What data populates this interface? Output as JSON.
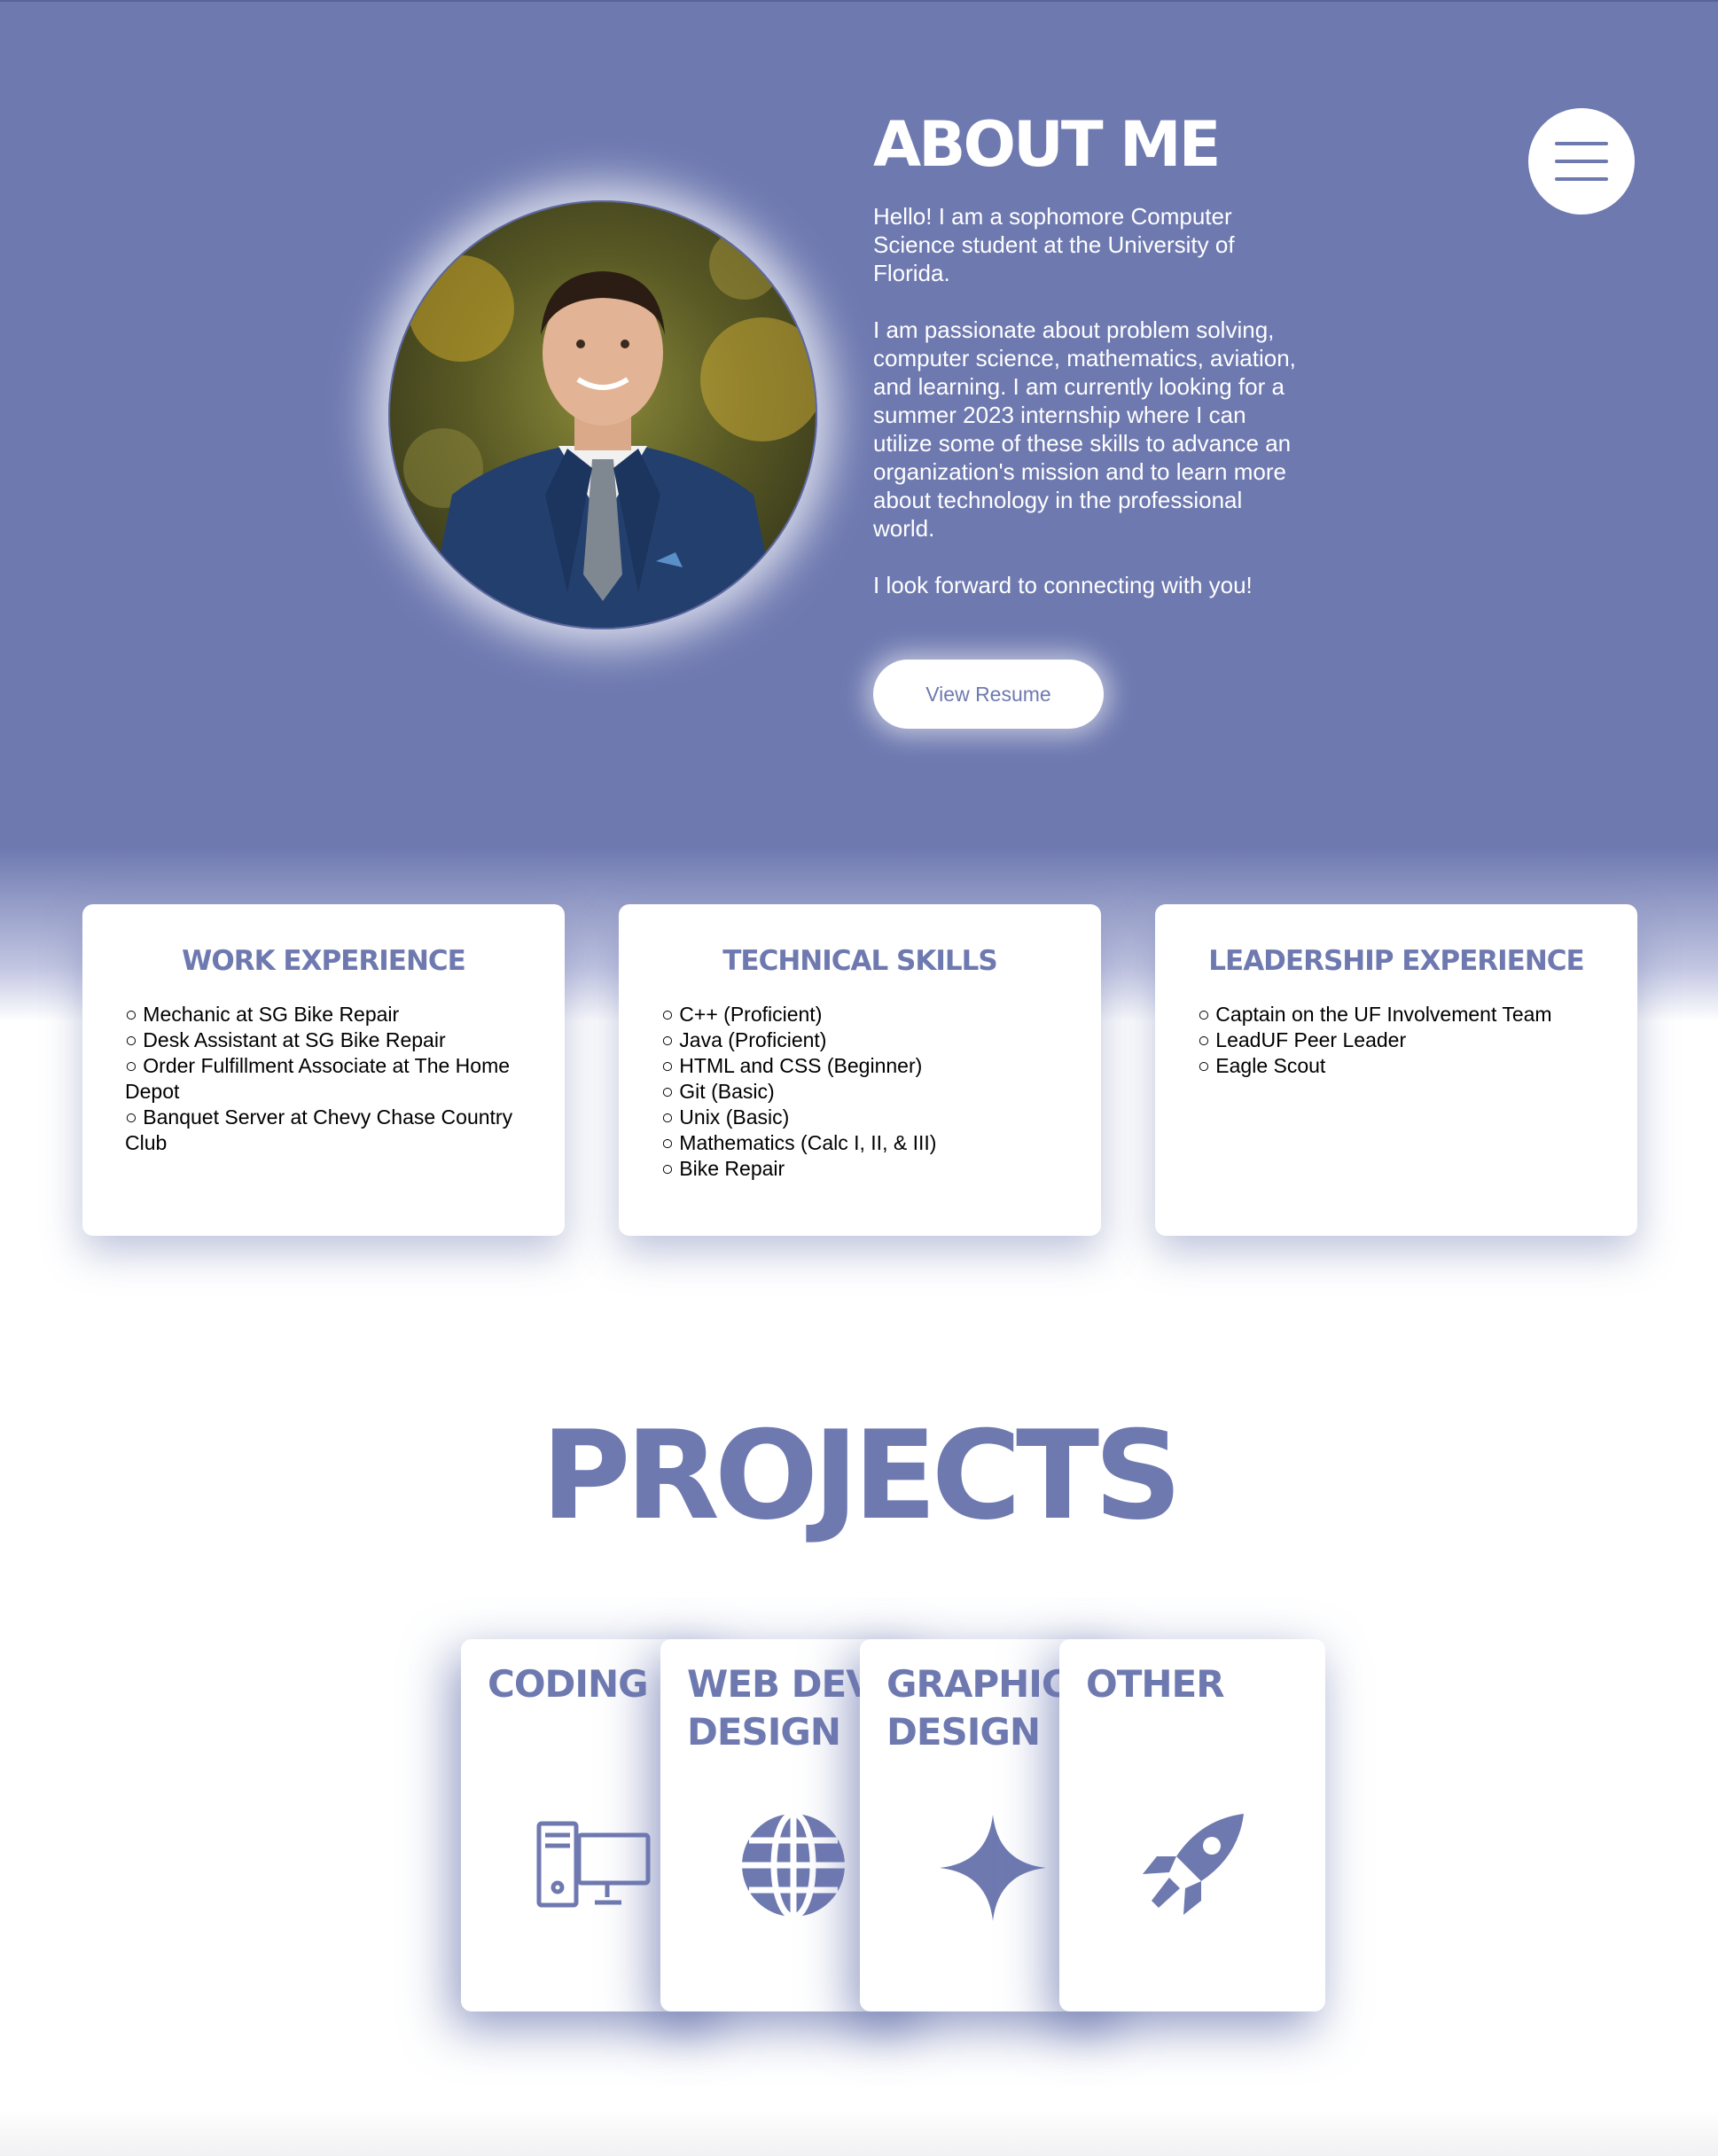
{
  "about": {
    "title": "ABOUT ME",
    "para1": "Hello! I am a sophomore Computer Science student at the University of Florida.",
    "para2": "I am passionate about problem solving, computer science, mathematics, aviation, and learning. I am currently looking for a summer 2023 internship where I can utilize some of these skills to advance an organization's mission and to learn more about technology in the professional world.",
    "para3": "I look forward to connecting with you!",
    "resume_button": "View Resume"
  },
  "cards": [
    {
      "title": "WORK EXPERIENCE",
      "items": [
        "Mechanic at SG Bike Repair",
        "Desk Assistant at SG Bike Repair",
        "Order Fulfillment Associate at The Home Depot",
        "Banquet Server at Chevy Chase Country Club"
      ]
    },
    {
      "title": "TECHNICAL SKILLS",
      "items": [
        "C++ (Proficient)",
        "Java (Proficient)",
        "HTML and CSS (Beginner)",
        "Git (Basic)",
        "Unix (Basic)",
        "Mathematics (Calc I, II, & III)",
        "Bike Repair"
      ]
    },
    {
      "title": "LEADERSHIP EXPERIENCE",
      "items": [
        "Captain on the UF Involvement Team",
        "LeadUF Peer Leader",
        "Eagle Scout"
      ]
    }
  ],
  "projects": {
    "title": "PROJECTS",
    "categories": [
      {
        "label": "CODING",
        "icon": "computer-icon"
      },
      {
        "label": "WEB DEV\nDESIGN",
        "icon": "globe-icon"
      },
      {
        "label": "GRAPHIC\nDESIGN",
        "icon": "sparkle-icon"
      },
      {
        "label": "OTHER",
        "icon": "rocket-icon"
      }
    ]
  },
  "colors": {
    "accent": "#6e79b0",
    "white": "#ffffff"
  }
}
